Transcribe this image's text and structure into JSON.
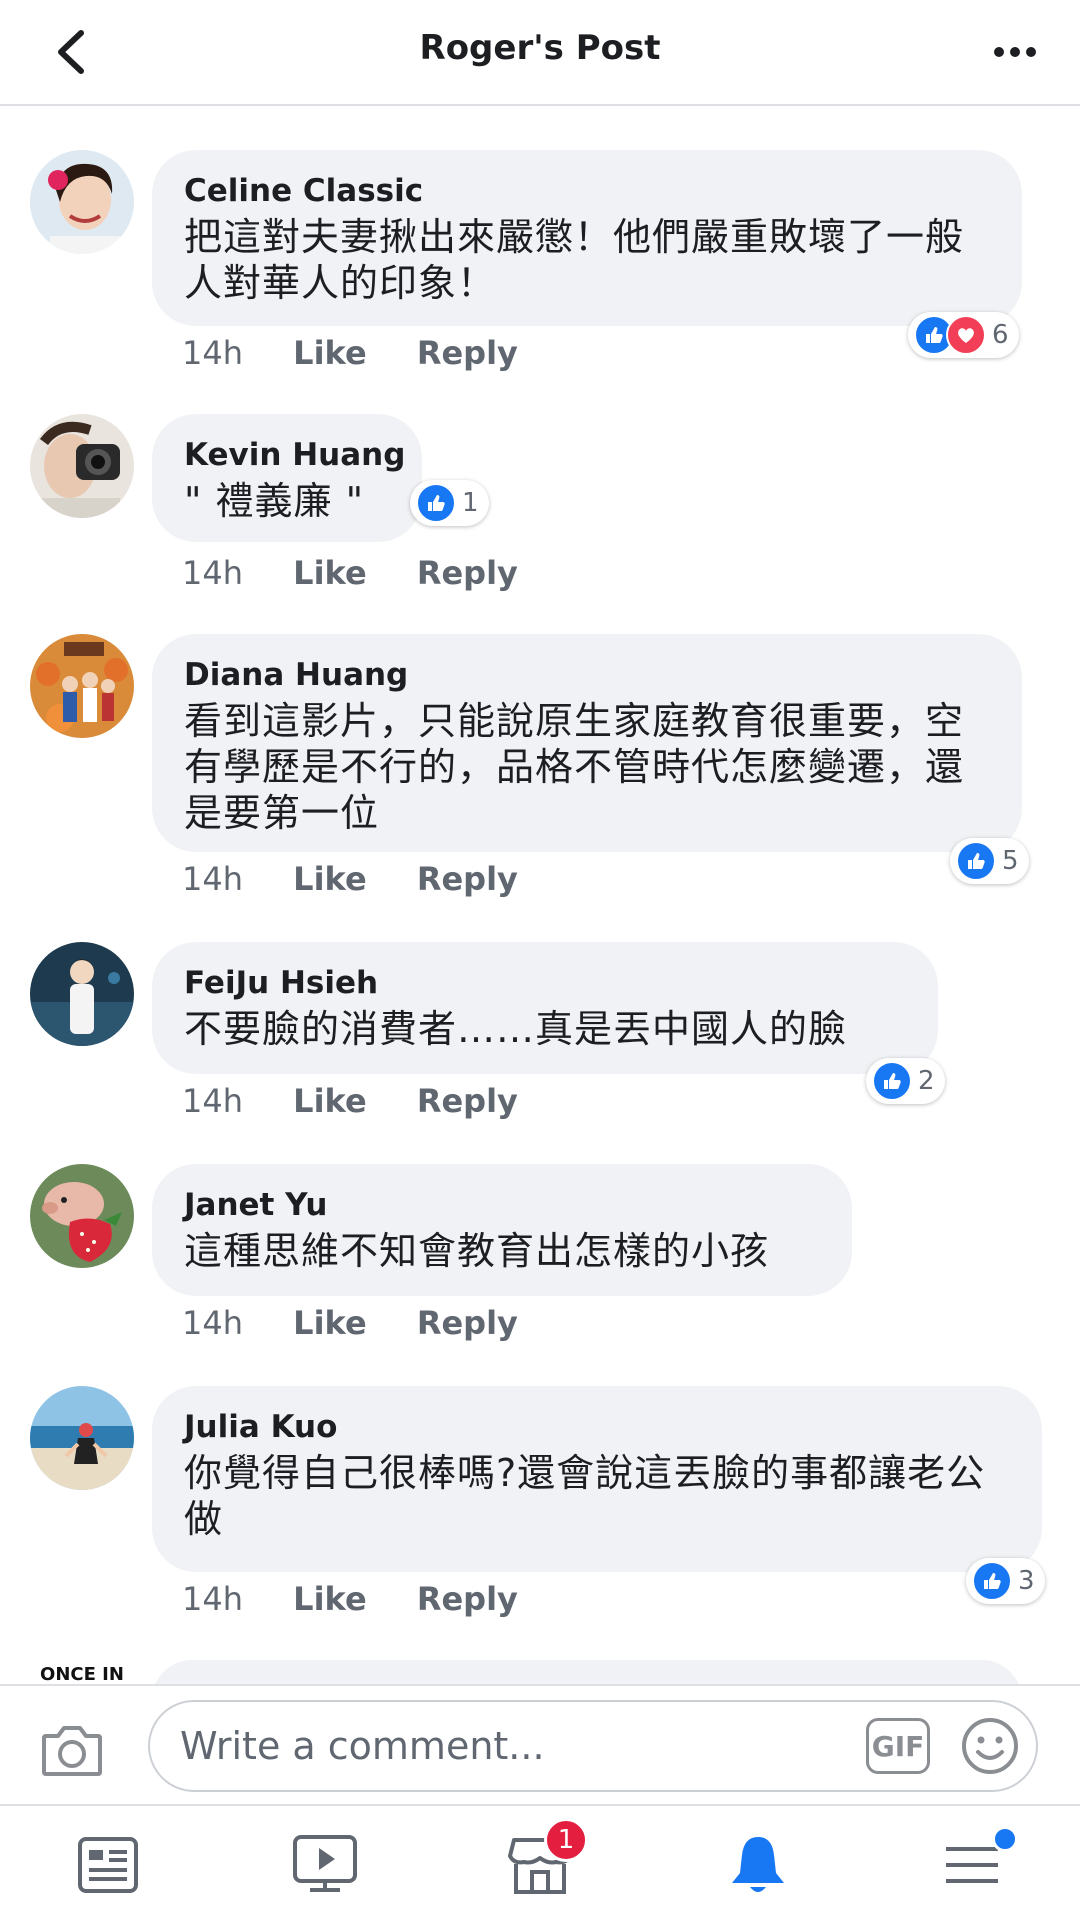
{
  "header": {
    "title": "Roger's Post"
  },
  "comments": [
    {
      "name": "Celine Classic",
      "text": "把這對夫妻揪出來嚴懲！他們嚴重敗壞了一般人對華人的印象！",
      "time": "14h",
      "like": "Like",
      "reply": "Reply",
      "reaction_count": "6",
      "reactions": [
        "like-icon",
        "love-icon"
      ]
    },
    {
      "name": "Kevin Huang",
      "text": "\" 禮義廉 \"",
      "time": "14h",
      "like": "Like",
      "reply": "Reply",
      "reaction_count": "1",
      "reactions": [
        "like-icon"
      ]
    },
    {
      "name": "Diana Huang",
      "text": "看到這影片，只能說原生家庭教育很重要，空有學歷是不行的，品格不管時代怎麼變遷，還是要第一位",
      "time": "14h",
      "like": "Like",
      "reply": "Reply",
      "reaction_count": "5",
      "reactions": [
        "like-icon"
      ]
    },
    {
      "name": "FeiJu Hsieh",
      "text": "不要臉的消費者……真是丟中國人的臉",
      "time": "14h",
      "like": "Like",
      "reply": "Reply",
      "reaction_count": "2",
      "reactions": [
        "like-icon"
      ]
    },
    {
      "name": "Janet Yu",
      "text": "這種思維不知會教育出怎樣的小孩",
      "time": "14h",
      "like": "Like",
      "reply": "Reply"
    },
    {
      "name": "Julia Kuo",
      "text": "你覺得自己很棒嗎?還會說這丟臉的事都讓老公做",
      "time": "14h",
      "like": "Like",
      "reply": "Reply",
      "reaction_count": "3",
      "reactions": [
        "like-icon"
      ]
    }
  ],
  "partial_avatar_text": "ONCE IN",
  "composer": {
    "placeholder": "Write a comment...",
    "gif_label": "GIF"
  },
  "nav": {
    "marketplace_badge": "1"
  },
  "colors": {
    "like": "#1877f2",
    "love": "#f33e58",
    "bubble": "#f0f2f5",
    "badge": "#e41e3f"
  }
}
